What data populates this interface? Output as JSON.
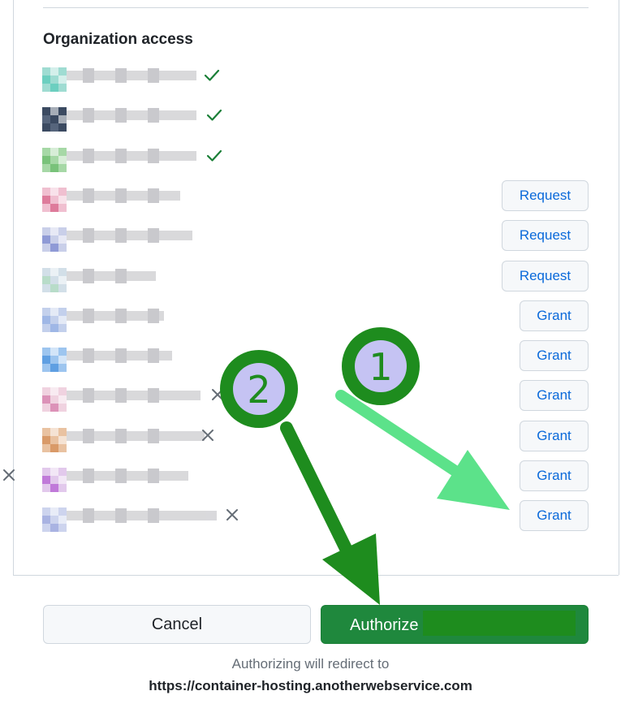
{
  "heading": "Organization access",
  "organizations": [
    {
      "status": "granted",
      "action": "",
      "colors": [
        "#9fdcd2",
        "#6ccfc0"
      ]
    },
    {
      "status": "granted",
      "action": "",
      "colors": [
        "#3b4a61",
        "#56657c"
      ]
    },
    {
      "status": "granted",
      "action": "",
      "colors": [
        "#a6d8a6",
        "#79c27a"
      ]
    },
    {
      "status": "pending",
      "action": "Request",
      "colors": [
        "#f0bfd0",
        "#de7b9b"
      ]
    },
    {
      "status": "pending",
      "action": "Request",
      "colors": [
        "#c9cfe9",
        "#8f9ad6"
      ]
    },
    {
      "status": "pending",
      "action": "Request",
      "colors": [
        "#d2dfe8",
        "#b8dcc9"
      ]
    },
    {
      "status": "pending",
      "action": "Grant",
      "colors": [
        "#c3d0ec",
        "#9fb7e6"
      ]
    },
    {
      "status": "pending",
      "action": "Grant",
      "colors": [
        "#9dc5ef",
        "#5f9fe2"
      ]
    },
    {
      "status": "denied",
      "action": "Grant",
      "colors": [
        "#f0d2e0",
        "#dc92b8"
      ]
    },
    {
      "status": "denied",
      "action": "Grant",
      "colors": [
        "#e9c2a1",
        "#d99a68"
      ]
    },
    {
      "status": "denied",
      "action": "Grant",
      "colors": [
        "#e2c9ec",
        "#c07ad9"
      ]
    },
    {
      "status": "denied",
      "action": "Grant",
      "colors": [
        "#cdd4ee",
        "#a9b3e2"
      ]
    }
  ],
  "buttons": {
    "cancel": "Cancel",
    "authorize": "Authorize"
  },
  "redirect": {
    "note": "Authorizing will redirect to",
    "url": "https://container-hosting.anotherwebservice.com"
  },
  "annotations": [
    {
      "label": "1",
      "points_to": "Grant"
    },
    {
      "label": "2",
      "points_to": "Authorize"
    }
  ],
  "colors": {
    "check": "#1a7f37",
    "x": "#656d76",
    "primary": "#1f883d",
    "link": "#0969da",
    "arrow1": "#5ce28a",
    "arrow2": "#1e8c1e",
    "badge_fill": "#c5c3f3"
  }
}
